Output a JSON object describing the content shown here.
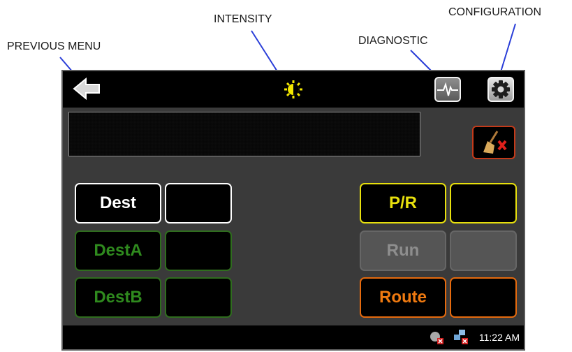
{
  "callouts": {
    "previous_menu": "PREVIOUS MENU",
    "intensity": "INTENSITY",
    "diagnostic": "DIAGNOSTIC",
    "configuration": "CONFIGURATION"
  },
  "icons": {
    "back": "back-arrow-icon",
    "intensity": "brightness-icon",
    "diagnostic": "heartbeat-icon",
    "configuration": "gear-icon",
    "clear": "broom-clear-icon",
    "tray_1": "network-error-icon",
    "tray_2": "network-disconnected-icon"
  },
  "left_keys": [
    {
      "label": "Dest",
      "color": "white"
    },
    {
      "label": "DestA",
      "color": "green"
    },
    {
      "label": "DestB",
      "color": "green"
    }
  ],
  "right_keys": [
    {
      "label": "P/R",
      "color": "yellow"
    },
    {
      "label": "Run",
      "color": "gray-disabled"
    },
    {
      "label": "Route",
      "color": "orange"
    }
  ],
  "status_bar": {
    "time": "11:22 AM"
  },
  "colors": {
    "white": "#ffffff",
    "green": "#2f8a1e",
    "yellow": "#e8e00d",
    "orange": "#f07a10",
    "disabled": "#8e8e8e",
    "clear_border": "#c33a1a",
    "callout_line": "#2a3ed8"
  }
}
